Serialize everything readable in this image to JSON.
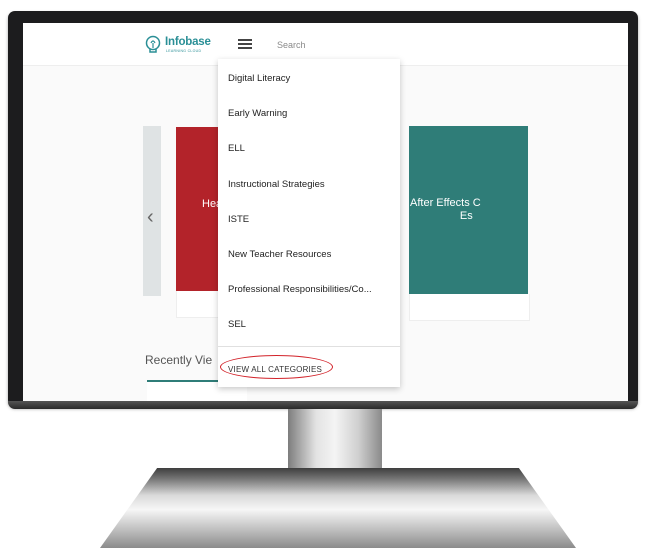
{
  "header": {
    "logo_name": "Infobase",
    "logo_subtitle": "LEARNING CLOUD",
    "search_placeholder": "Search"
  },
  "carousel": {
    "left_card_title": "Hea",
    "right_card_title": "After Effects C",
    "right_card_title_line2": "Es",
    "prev_arrow": "‹"
  },
  "recent": {
    "label": "Recently Vie"
  },
  "categories_menu": {
    "items": [
      "Digital Literacy",
      "Early Warning",
      "ELL",
      "Instructional Strategies",
      "ISTE",
      "New Teacher Resources",
      "Professional Responsibilities/Co...",
      "SEL"
    ],
    "footer_link": "VIEW ALL CATEGORIES"
  },
  "colors": {
    "brand": "#2a8f96",
    "card_red": "#b3232a",
    "card_teal": "#2f7d78",
    "annotation": "#d2232a"
  }
}
